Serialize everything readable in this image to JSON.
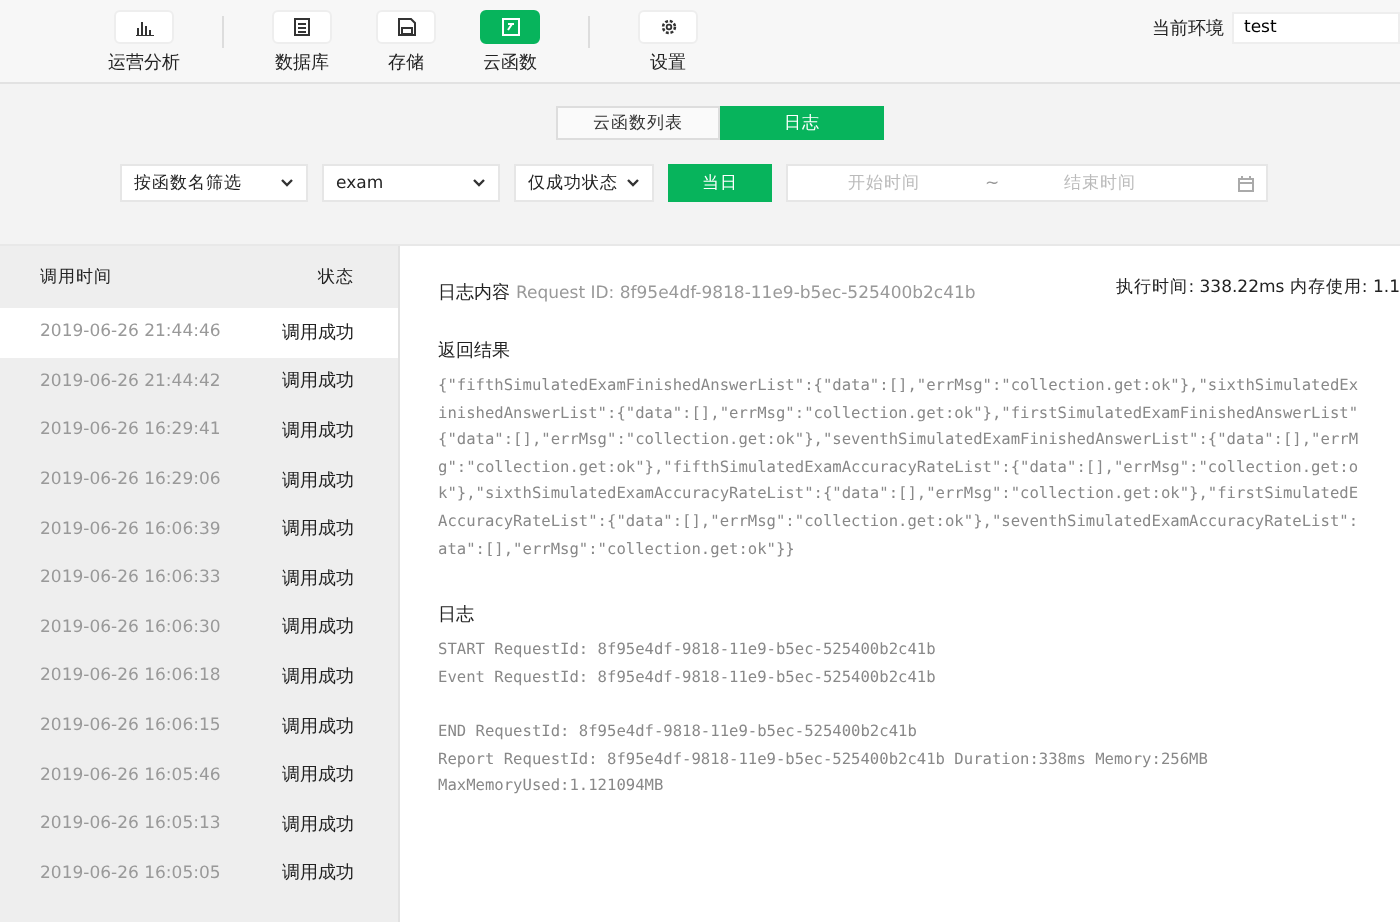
{
  "toolbar": {
    "groups": [
      [
        {
          "kind": "chart",
          "label": "运营分析",
          "selected": false
        }
      ],
      [
        {
          "kind": "database",
          "label": "数据库",
          "selected": false
        },
        {
          "kind": "storage",
          "label": "存储",
          "selected": false
        },
        {
          "kind": "function",
          "label": "云函数",
          "selected": true
        }
      ],
      [
        {
          "kind": "settings",
          "label": "设置",
          "selected": false
        }
      ]
    ],
    "environment": {
      "label": "当前环境",
      "value": "test"
    }
  },
  "tabs": [
    {
      "label": "云函数列表",
      "selected": false
    },
    {
      "label": "日志",
      "selected": true
    }
  ],
  "filters": {
    "function_filter": "按函数名筛选",
    "function_name": "exam",
    "status_filter": "仅成功状态",
    "today_button": "当日",
    "start_placeholder": "开始时间",
    "separator": "~",
    "end_placeholder": "结束时间"
  },
  "log_list": {
    "columns": [
      "调用时间",
      "状态"
    ],
    "rows": [
      {
        "time": "2019-06-26 21:44:46",
        "status": "调用成功",
        "selected": true
      },
      {
        "time": "2019-06-26 21:44:42",
        "status": "调用成功",
        "selected": false
      },
      {
        "time": "2019-06-26 16:29:41",
        "status": "调用成功",
        "selected": false
      },
      {
        "time": "2019-06-26 16:29:06",
        "status": "调用成功",
        "selected": false
      },
      {
        "time": "2019-06-26 16:06:39",
        "status": "调用成功",
        "selected": false
      },
      {
        "time": "2019-06-26 16:06:33",
        "status": "调用成功",
        "selected": false
      },
      {
        "time": "2019-06-26 16:06:30",
        "status": "调用成功",
        "selected": false
      },
      {
        "time": "2019-06-26 16:06:18",
        "status": "调用成功",
        "selected": false
      },
      {
        "time": "2019-06-26 16:06:15",
        "status": "调用成功",
        "selected": false
      },
      {
        "time": "2019-06-26 16:05:46",
        "status": "调用成功",
        "selected": false
      },
      {
        "time": "2019-06-26 16:05:13",
        "status": "调用成功",
        "selected": false
      },
      {
        "time": "2019-06-26 16:05:05",
        "status": "调用成功",
        "selected": false
      }
    ]
  },
  "log_detail": {
    "title": "日志内容",
    "request_id": "Request ID: 8f95e4df-9818-11e9-b5ec-525400b2c41b",
    "stats": "执行时间: 338.22ms   内存使用: 1.1",
    "result_heading": "返回结果",
    "result_lines": [
      "{\"fifthSimulatedExamFinishedAnswerList\":{\"data\":[],\"errMsg\":\"collection.get:ok\"},\"sixthSimulatedEx",
      "inishedAnswerList\":{\"data\":[],\"errMsg\":\"collection.get:ok\"},\"firstSimulatedExamFinishedAnswerList\"",
      "{\"data\":[],\"errMsg\":\"collection.get:ok\"},\"seventhSimulatedExamFinishedAnswerList\":{\"data\":[],\"errM",
      "g\":\"collection.get:ok\"},\"fifthSimulatedExamAccuracyRateList\":{\"data\":[],\"errMsg\":\"collection.get:o",
      "k\"},\"sixthSimulatedExamAccuracyRateList\":{\"data\":[],\"errMsg\":\"collection.get:ok\"},\"firstSimulatedE",
      "AccuracyRateList\":{\"data\":[],\"errMsg\":\"collection.get:ok\"},\"seventhSimulatedExamAccuracyRateList\":",
      "ata\":[],\"errMsg\":\"collection.get:ok\"}}"
    ],
    "log_heading": "日志",
    "log_groups": [
      [
        "START RequestId: 8f95e4df-9818-11e9-b5ec-525400b2c41b",
        "Event RequestId: 8f95e4df-9818-11e9-b5ec-525400b2c41b"
      ],
      [
        "END RequestId: 8f95e4df-9818-11e9-b5ec-525400b2c41b",
        "Report RequestId: 8f95e4df-9818-11e9-b5ec-525400b2c41b Duration:338ms Memory:256MB",
        "MaxMemoryUsed:1.121094MB"
      ]
    ]
  }
}
